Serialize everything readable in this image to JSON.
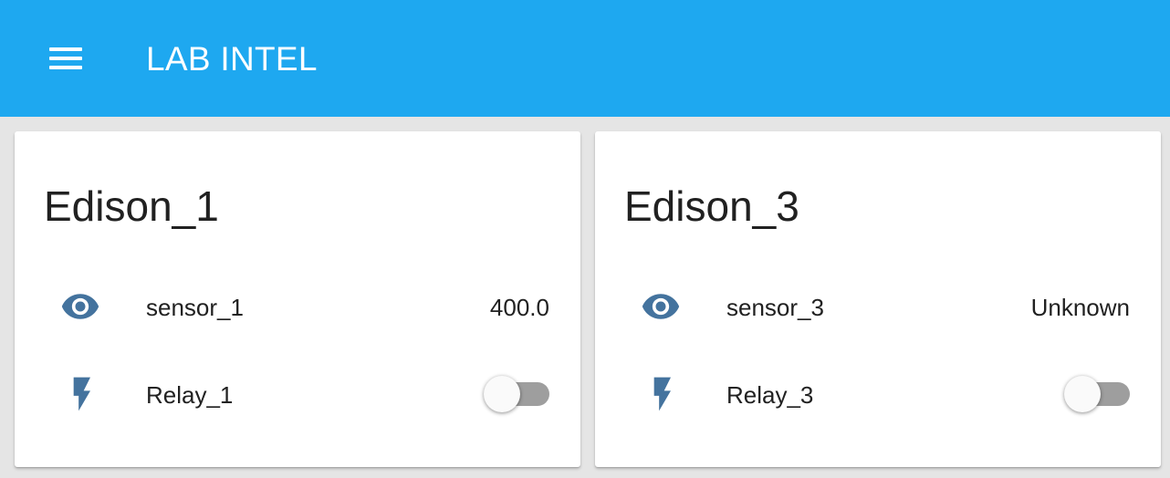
{
  "toolbar": {
    "menu_icon": "hamburger-menu-icon",
    "title": "LAB INTEL",
    "background": "#1ea8f0"
  },
  "cards": [
    {
      "title": "Edison_1",
      "rows": [
        {
          "icon": "eye-icon",
          "name": "sensor_1",
          "value": "400.0"
        },
        {
          "icon": "lightning-bolt-icon",
          "name": "Relay_1",
          "toggle_on": false
        }
      ]
    },
    {
      "title": "Edison_3",
      "rows": [
        {
          "icon": "eye-icon",
          "name": "sensor_3",
          "value": "Unknown"
        },
        {
          "icon": "lightning-bolt-icon",
          "name": "Relay_3",
          "toggle_on": false
        }
      ]
    }
  ],
  "colors": {
    "icon": "#44739e",
    "toggle_off_track": "#9e9e9e",
    "background": "#e5e5e5"
  }
}
